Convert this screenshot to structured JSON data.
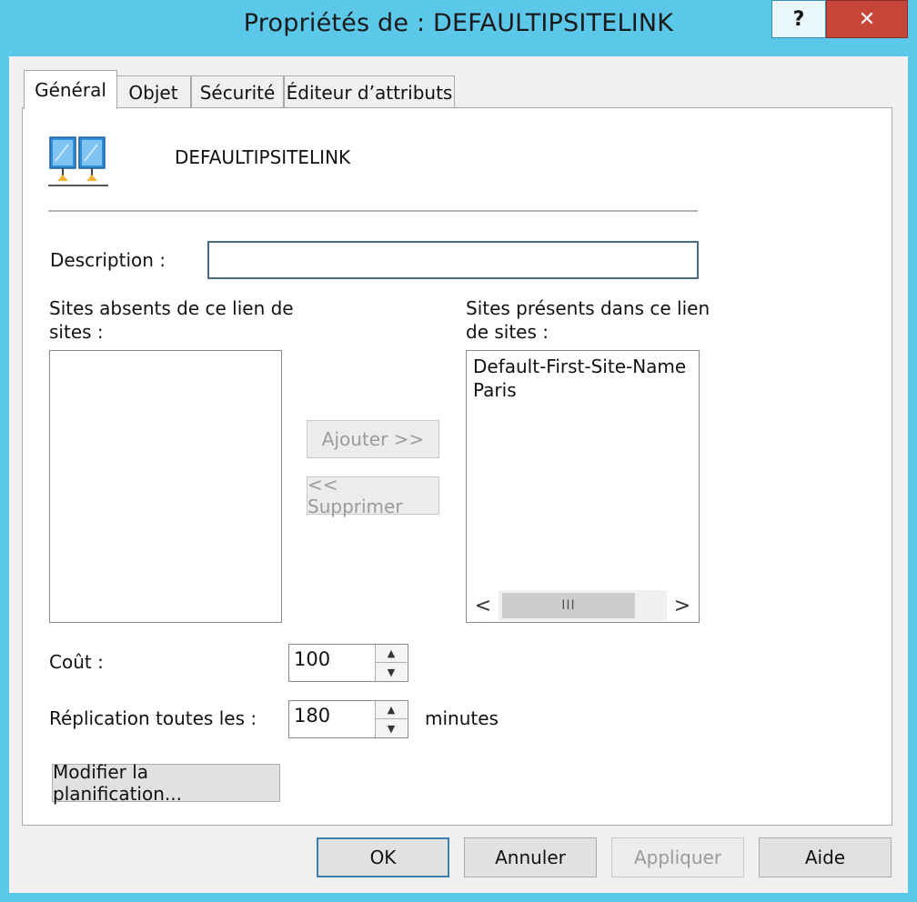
{
  "window": {
    "title": "Propriétés de : DEFAULTIPSITELINK",
    "help_label": "?",
    "close_label": "✕"
  },
  "tabs": [
    {
      "label": "Général",
      "active": true
    },
    {
      "label": "Objet",
      "active": false
    },
    {
      "label": "Sécurité",
      "active": false
    },
    {
      "label": "Éditeur d’attributs",
      "active": false
    }
  ],
  "general": {
    "object_name": "DEFAULTIPSITELINK",
    "icon": "site-link-icon",
    "description_label": "Description :",
    "description_value": "",
    "absent_sites_label_line1": "Sites absents de ce lien de",
    "absent_sites_label_line2": "sites :",
    "absent_sites": [],
    "present_sites_label_line1": "Sites présents dans ce lien",
    "present_sites_label_line2": "de sites :",
    "present_sites": [
      "Default-First-Site-Name",
      "Paris"
    ],
    "scroll_thumb_label": "III",
    "scroll_left": "<",
    "scroll_right": ">",
    "add_button": "Ajouter >>",
    "remove_button": "<< Supprimer",
    "cost_label": "Coût :",
    "cost_value": "100",
    "replication_label": "Réplication toutes les :",
    "replication_value": "180",
    "replication_unit": "minutes",
    "schedule_button": "Modifier la planification..."
  },
  "footer": {
    "ok": "OK",
    "cancel": "Annuler",
    "apply": "Appliquer",
    "help": "Aide"
  },
  "colors": {
    "title_bar": "#5bc8ea",
    "close_button": "#c7463a",
    "default_button_border": "#3c7fb1"
  }
}
